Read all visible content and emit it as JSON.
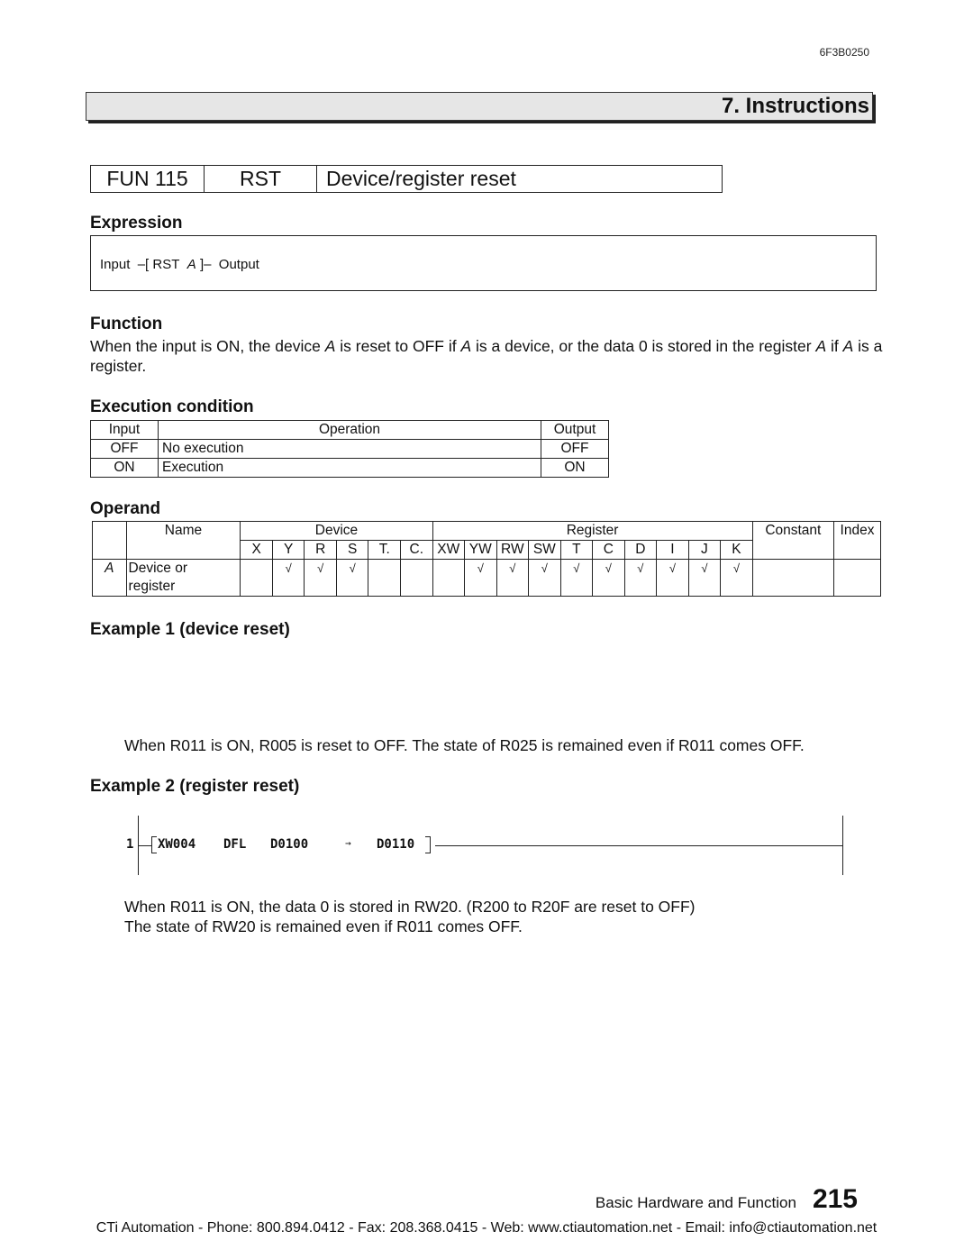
{
  "header": {
    "doc_code": "6F3B0250",
    "chapter_title": "7. Instructions"
  },
  "instruction": {
    "fun": "FUN 115",
    "mnemonic": "RST",
    "name": "Device/register reset"
  },
  "expression": {
    "heading": "Expression",
    "input": "Input",
    "open": "–[ RST",
    "operand": "A",
    "close": "]–",
    "output": "Output"
  },
  "function": {
    "heading": "Function",
    "text_parts": [
      "When the input is ON, the device ",
      "A",
      " is reset to OFF if ",
      "A",
      " is a device, or the data 0 is stored in the register ",
      "A",
      " if ",
      "A",
      " is a register."
    ]
  },
  "execution_condition": {
    "heading": "Execution condition",
    "columns": [
      "Input",
      "Operation",
      "Output"
    ],
    "rows": [
      {
        "input": "OFF",
        "operation": "No execution",
        "output": "OFF"
      },
      {
        "input": "ON",
        "operation": "Execution",
        "output": "ON"
      }
    ]
  },
  "operand": {
    "heading": "Operand",
    "name_header": "Name",
    "device_header": "Device",
    "register_header": "Register",
    "constant_header": "Constant",
    "index_header": "Index",
    "device_cols": [
      "X",
      "Y",
      "R",
      "S",
      "T.",
      "C."
    ],
    "register_cols": [
      "XW",
      "YW",
      "RW",
      "SW",
      "T",
      "C",
      "D",
      "I",
      "J",
      "K"
    ],
    "rows": [
      {
        "symbol": "A",
        "name_line1": "Device or",
        "name_line2": "register",
        "device_checks": [
          "",
          "√",
          "√",
          "√",
          "",
          ""
        ],
        "register_checks": [
          "",
          "√",
          "√",
          "√",
          "√",
          "√",
          "√",
          "√",
          "√",
          "√"
        ],
        "constant": "",
        "index": ""
      }
    ]
  },
  "example1": {
    "heading": "Example 1 (device reset)",
    "description": "When R011 is ON, R005 is reset to OFF. The state of R025 is remained even if R011 comes OFF."
  },
  "example2": {
    "heading": "Example 2 (register reset)",
    "ladder": {
      "rung_number": "1",
      "source": "XW004",
      "op": "DFL",
      "operand1": "D0100",
      "arrow": "→",
      "operand2": "D0110"
    },
    "description_line1": "When R011 is ON, the data 0 is stored in RW20. (R200 to R20F are reset to OFF)",
    "description_line2": "The state of RW20 is remained even if R011 comes OFF."
  },
  "footer": {
    "book_title": "Basic Hardware and Function",
    "page_number": "215",
    "contact": "CTi Automation - Phone: 800.894.0412 - Fax: 208.368.0415 - Web: www.ctiautomation.net - Email: info@ctiautomation.net"
  }
}
